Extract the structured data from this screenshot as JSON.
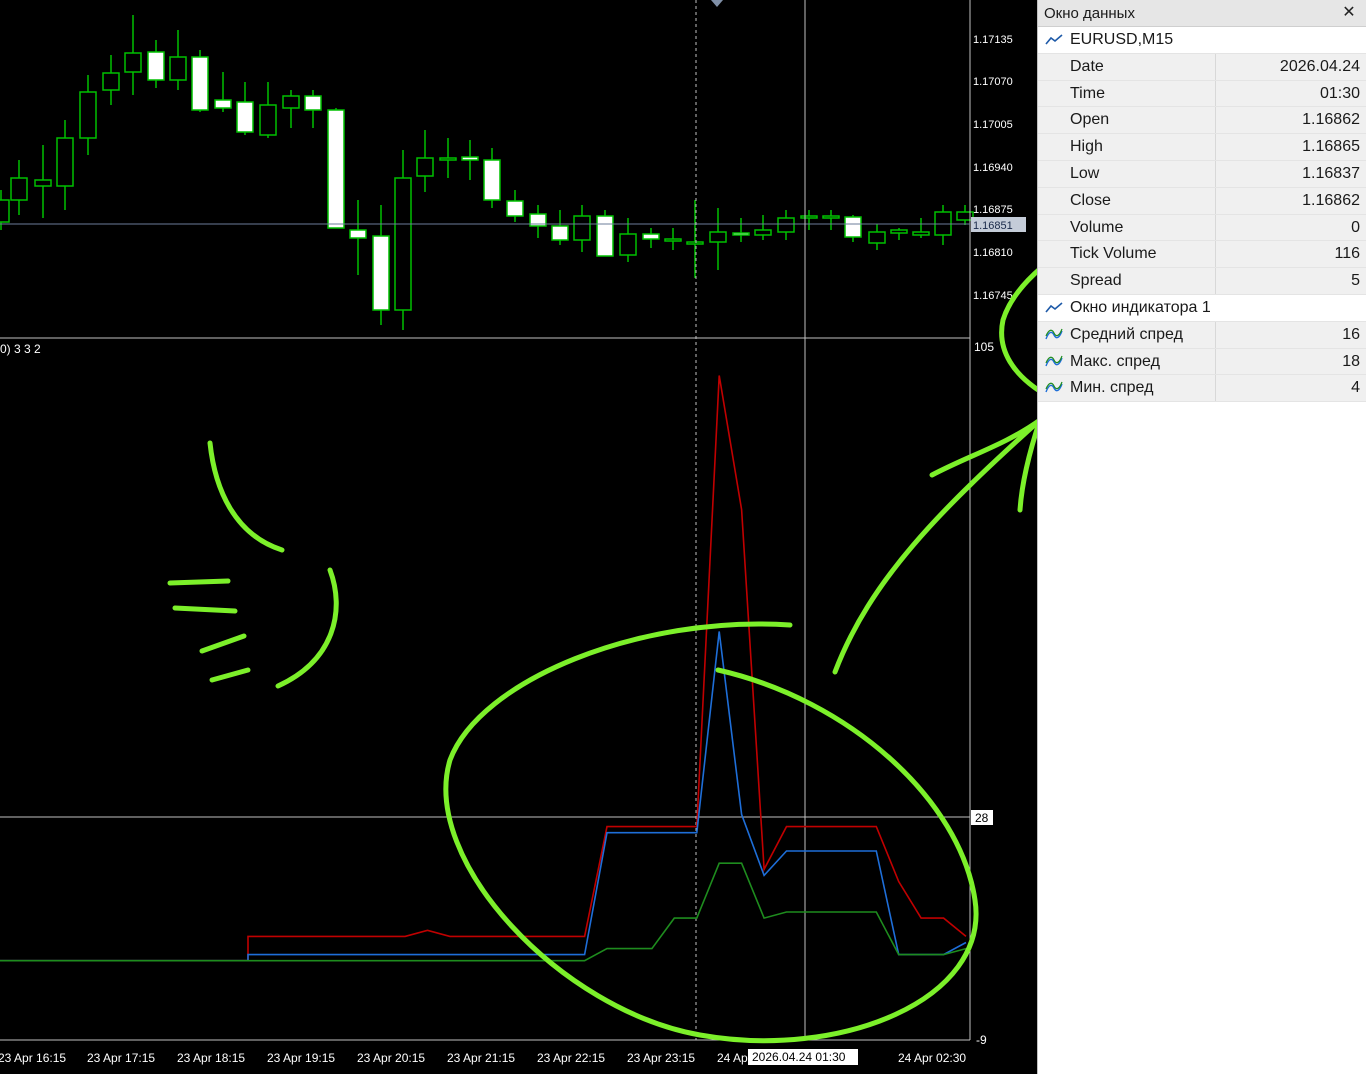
{
  "chart": {
    "price_axis_labels": [
      "1.17135",
      "1.17070",
      "1.17005",
      "1.16940",
      "1.16875",
      "1.16810",
      "1.16745"
    ],
    "current_price_label": "1.16851",
    "indicator_header": "0) 3 3 2",
    "indicator_axis_labels": [
      "105",
      "28",
      "-9"
    ],
    "time_axis_labels": [
      "23 Apr 16:15",
      "23 Apr 17:15",
      "23 Apr 18:15",
      "23 Apr 19:15",
      "23 Apr 20:15",
      "23 Apr 21:15",
      "23 Apr 22:15",
      "23 Apr 23:15",
      "24 Apr",
      "24 Apr 02:30"
    ],
    "crosshair_time_label": "2026.04.24 01:30",
    "colors": {
      "background": "#000000",
      "bull_candle": "#00c000",
      "bear_candle": "#ffffff",
      "crosshair": "#c0c0c0",
      "line_max": "#c00000",
      "line_avg": "#1e6ed8",
      "line_min": "#1e8c1e",
      "annotation": "#7cf02a"
    }
  },
  "chart_data": {
    "type": "line",
    "title": "",
    "xlabel": "",
    "ylabel": "",
    "ylim": [
      -9,
      105
    ],
    "x": [
      "16:15",
      "16:30",
      "16:45",
      "17:00",
      "17:15",
      "17:30",
      "17:45",
      "18:00",
      "18:15",
      "18:30",
      "18:45",
      "19:00",
      "19:15",
      "19:30",
      "19:45",
      "20:00",
      "20:15",
      "20:30",
      "20:45",
      "21:00",
      "21:15",
      "21:30",
      "21:45",
      "22:00",
      "22:15",
      "22:30",
      "22:45",
      "23:00",
      "23:15",
      "23:30",
      "23:45",
      "00:00",
      "00:15",
      "00:30",
      "00:45",
      "01:00",
      "01:15",
      "01:30",
      "01:45",
      "02:00",
      "02:15",
      "02:30"
    ],
    "series": [
      {
        "name": "Макс. спред",
        "color": "#c00000",
        "values": [
          4,
          4,
          4,
          4,
          4,
          4,
          4,
          4,
          4,
          4,
          4,
          8,
          8,
          8,
          8,
          8,
          8,
          8,
          8,
          9,
          8,
          8,
          8,
          8,
          8,
          8,
          8,
          26,
          26,
          26,
          26,
          26,
          100,
          78,
          19,
          26,
          26,
          26,
          26,
          26,
          17,
          11,
          11,
          8
        ]
      },
      {
        "name": "Средний спред",
        "color": "#1e6ed8",
        "values": [
          4,
          4,
          4,
          4,
          4,
          4,
          4,
          4,
          4,
          4,
          4,
          5,
          5,
          5,
          5,
          5,
          5,
          5,
          5,
          5,
          5,
          5,
          5,
          5,
          5,
          5,
          5,
          25,
          25,
          25,
          25,
          25,
          58,
          28,
          18,
          22,
          22,
          22,
          22,
          22,
          5,
          5,
          5,
          7
        ]
      },
      {
        "name": "Мин. спред",
        "color": "#1e8c1e",
        "values": [
          4,
          4,
          4,
          4,
          4,
          4,
          4,
          4,
          4,
          4,
          4,
          4,
          4,
          4,
          4,
          4,
          4,
          4,
          4,
          4,
          4,
          4,
          4,
          4,
          4,
          4,
          4,
          6,
          6,
          6,
          11,
          11,
          20,
          20,
          11,
          12,
          12,
          12,
          12,
          12,
          5,
          5,
          5,
          6
        ]
      }
    ]
  },
  "data_window": {
    "title": "Окно данных",
    "close_label": "✕",
    "symbol": "EURUSD,M15",
    "rows": [
      {
        "label": "Date",
        "value": "2026.04.24"
      },
      {
        "label": "Time",
        "value": "01:30"
      },
      {
        "label": "Open",
        "value": "1.16862"
      },
      {
        "label": "High",
        "value": "1.16865"
      },
      {
        "label": "Low",
        "value": "1.16837"
      },
      {
        "label": "Close",
        "value": "1.16862"
      },
      {
        "label": "Volume",
        "value": "0"
      },
      {
        "label": "Tick Volume",
        "value": "116"
      },
      {
        "label": "Spread",
        "value": "5"
      }
    ],
    "indicator_header": "Окно индикатора 1",
    "indicator_rows": [
      {
        "label": "Средний спред",
        "value": "16"
      },
      {
        "label": "Макс. спред",
        "value": "18"
      },
      {
        "label": "Мин. спред",
        "value": "4"
      }
    ]
  }
}
